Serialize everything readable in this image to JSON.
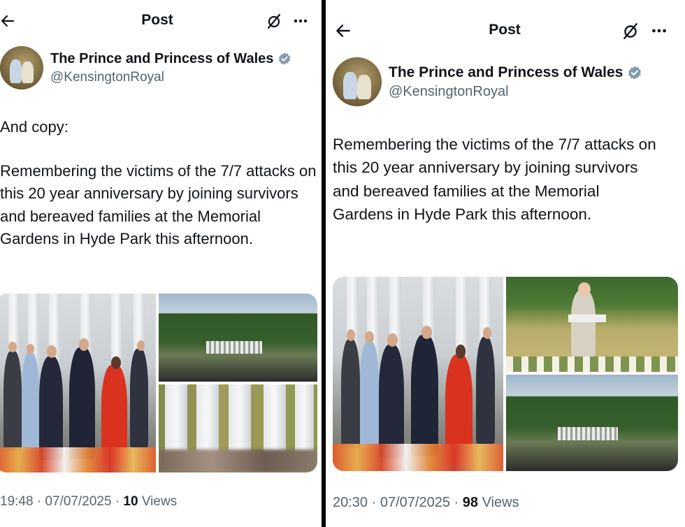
{
  "left": {
    "header": {
      "title": "Post"
    },
    "author": {
      "name": "The Prince and Princess of Wales",
      "handle": "@KensingtonRoyal"
    },
    "text": {
      "lead": "And copy:",
      "body": "Remembering the victims of the 7/7 attacks on this 20 year anniversary by joining survivors and bereaved families at the Memorial Gardens in Hyde Park this afternoon."
    },
    "meta": {
      "time": "19:48",
      "date": "07/07/2025",
      "views_count": "10",
      "views_label": "Views",
      "sep": "·"
    }
  },
  "right": {
    "header": {
      "title": "Post"
    },
    "author": {
      "name": "The Prince and Princess of Wales",
      "handle": "@KensingtonRoyal"
    },
    "text": {
      "body": "Remembering the victims of the 7/7 attacks on this 20 year anniversary by joining survivors and bereaved families at the Memorial Gardens in Hyde Park this afternoon."
    },
    "meta": {
      "time": "20:30",
      "date": "07/07/2025",
      "views_count": "98",
      "views_label": "Views",
      "sep": "·"
    }
  },
  "colors": {
    "text": "#0f1419",
    "secondary": "#536471",
    "verified": "#829aab",
    "divider": "#000000"
  },
  "icons": [
    "back-arrow-icon",
    "grok-icon",
    "more-icon",
    "verified-badge-icon"
  ]
}
